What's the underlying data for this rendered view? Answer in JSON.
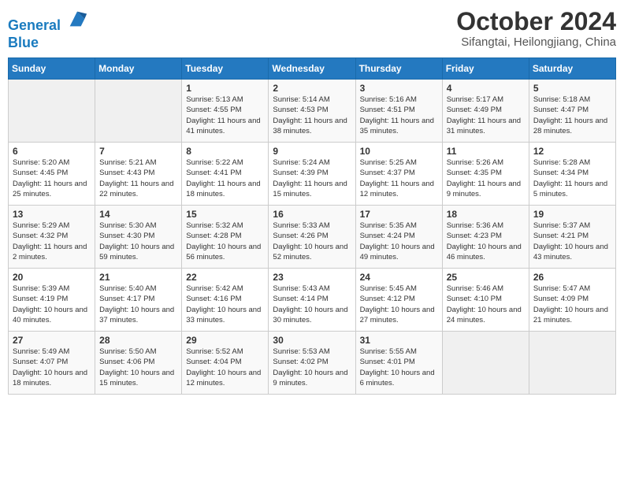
{
  "logo": {
    "line1": "General",
    "line2": "Blue"
  },
  "title": "October 2024",
  "subtitle": "Sifangtai, Heilongjiang, China",
  "days_of_week": [
    "Sunday",
    "Monday",
    "Tuesday",
    "Wednesday",
    "Thursday",
    "Friday",
    "Saturday"
  ],
  "weeks": [
    [
      {
        "day": "",
        "sunrise": "",
        "sunset": "",
        "daylight": ""
      },
      {
        "day": "",
        "sunrise": "",
        "sunset": "",
        "daylight": ""
      },
      {
        "day": "1",
        "sunrise": "Sunrise: 5:13 AM",
        "sunset": "Sunset: 4:55 PM",
        "daylight": "Daylight: 11 hours and 41 minutes."
      },
      {
        "day": "2",
        "sunrise": "Sunrise: 5:14 AM",
        "sunset": "Sunset: 4:53 PM",
        "daylight": "Daylight: 11 hours and 38 minutes."
      },
      {
        "day": "3",
        "sunrise": "Sunrise: 5:16 AM",
        "sunset": "Sunset: 4:51 PM",
        "daylight": "Daylight: 11 hours and 35 minutes."
      },
      {
        "day": "4",
        "sunrise": "Sunrise: 5:17 AM",
        "sunset": "Sunset: 4:49 PM",
        "daylight": "Daylight: 11 hours and 31 minutes."
      },
      {
        "day": "5",
        "sunrise": "Sunrise: 5:18 AM",
        "sunset": "Sunset: 4:47 PM",
        "daylight": "Daylight: 11 hours and 28 minutes."
      }
    ],
    [
      {
        "day": "6",
        "sunrise": "Sunrise: 5:20 AM",
        "sunset": "Sunset: 4:45 PM",
        "daylight": "Daylight: 11 hours and 25 minutes."
      },
      {
        "day": "7",
        "sunrise": "Sunrise: 5:21 AM",
        "sunset": "Sunset: 4:43 PM",
        "daylight": "Daylight: 11 hours and 22 minutes."
      },
      {
        "day": "8",
        "sunrise": "Sunrise: 5:22 AM",
        "sunset": "Sunset: 4:41 PM",
        "daylight": "Daylight: 11 hours and 18 minutes."
      },
      {
        "day": "9",
        "sunrise": "Sunrise: 5:24 AM",
        "sunset": "Sunset: 4:39 PM",
        "daylight": "Daylight: 11 hours and 15 minutes."
      },
      {
        "day": "10",
        "sunrise": "Sunrise: 5:25 AM",
        "sunset": "Sunset: 4:37 PM",
        "daylight": "Daylight: 11 hours and 12 minutes."
      },
      {
        "day": "11",
        "sunrise": "Sunrise: 5:26 AM",
        "sunset": "Sunset: 4:35 PM",
        "daylight": "Daylight: 11 hours and 9 minutes."
      },
      {
        "day": "12",
        "sunrise": "Sunrise: 5:28 AM",
        "sunset": "Sunset: 4:34 PM",
        "daylight": "Daylight: 11 hours and 5 minutes."
      }
    ],
    [
      {
        "day": "13",
        "sunrise": "Sunrise: 5:29 AM",
        "sunset": "Sunset: 4:32 PM",
        "daylight": "Daylight: 11 hours and 2 minutes."
      },
      {
        "day": "14",
        "sunrise": "Sunrise: 5:30 AM",
        "sunset": "Sunset: 4:30 PM",
        "daylight": "Daylight: 10 hours and 59 minutes."
      },
      {
        "day": "15",
        "sunrise": "Sunrise: 5:32 AM",
        "sunset": "Sunset: 4:28 PM",
        "daylight": "Daylight: 10 hours and 56 minutes."
      },
      {
        "day": "16",
        "sunrise": "Sunrise: 5:33 AM",
        "sunset": "Sunset: 4:26 PM",
        "daylight": "Daylight: 10 hours and 52 minutes."
      },
      {
        "day": "17",
        "sunrise": "Sunrise: 5:35 AM",
        "sunset": "Sunset: 4:24 PM",
        "daylight": "Daylight: 10 hours and 49 minutes."
      },
      {
        "day": "18",
        "sunrise": "Sunrise: 5:36 AM",
        "sunset": "Sunset: 4:23 PM",
        "daylight": "Daylight: 10 hours and 46 minutes."
      },
      {
        "day": "19",
        "sunrise": "Sunrise: 5:37 AM",
        "sunset": "Sunset: 4:21 PM",
        "daylight": "Daylight: 10 hours and 43 minutes."
      }
    ],
    [
      {
        "day": "20",
        "sunrise": "Sunrise: 5:39 AM",
        "sunset": "Sunset: 4:19 PM",
        "daylight": "Daylight: 10 hours and 40 minutes."
      },
      {
        "day": "21",
        "sunrise": "Sunrise: 5:40 AM",
        "sunset": "Sunset: 4:17 PM",
        "daylight": "Daylight: 10 hours and 37 minutes."
      },
      {
        "day": "22",
        "sunrise": "Sunrise: 5:42 AM",
        "sunset": "Sunset: 4:16 PM",
        "daylight": "Daylight: 10 hours and 33 minutes."
      },
      {
        "day": "23",
        "sunrise": "Sunrise: 5:43 AM",
        "sunset": "Sunset: 4:14 PM",
        "daylight": "Daylight: 10 hours and 30 minutes."
      },
      {
        "day": "24",
        "sunrise": "Sunrise: 5:45 AM",
        "sunset": "Sunset: 4:12 PM",
        "daylight": "Daylight: 10 hours and 27 minutes."
      },
      {
        "day": "25",
        "sunrise": "Sunrise: 5:46 AM",
        "sunset": "Sunset: 4:10 PM",
        "daylight": "Daylight: 10 hours and 24 minutes."
      },
      {
        "day": "26",
        "sunrise": "Sunrise: 5:47 AM",
        "sunset": "Sunset: 4:09 PM",
        "daylight": "Daylight: 10 hours and 21 minutes."
      }
    ],
    [
      {
        "day": "27",
        "sunrise": "Sunrise: 5:49 AM",
        "sunset": "Sunset: 4:07 PM",
        "daylight": "Daylight: 10 hours and 18 minutes."
      },
      {
        "day": "28",
        "sunrise": "Sunrise: 5:50 AM",
        "sunset": "Sunset: 4:06 PM",
        "daylight": "Daylight: 10 hours and 15 minutes."
      },
      {
        "day": "29",
        "sunrise": "Sunrise: 5:52 AM",
        "sunset": "Sunset: 4:04 PM",
        "daylight": "Daylight: 10 hours and 12 minutes."
      },
      {
        "day": "30",
        "sunrise": "Sunrise: 5:53 AM",
        "sunset": "Sunset: 4:02 PM",
        "daylight": "Daylight: 10 hours and 9 minutes."
      },
      {
        "day": "31",
        "sunrise": "Sunrise: 5:55 AM",
        "sunset": "Sunset: 4:01 PM",
        "daylight": "Daylight: 10 hours and 6 minutes."
      },
      {
        "day": "",
        "sunrise": "",
        "sunset": "",
        "daylight": ""
      },
      {
        "day": "",
        "sunrise": "",
        "sunset": "",
        "daylight": ""
      }
    ]
  ]
}
